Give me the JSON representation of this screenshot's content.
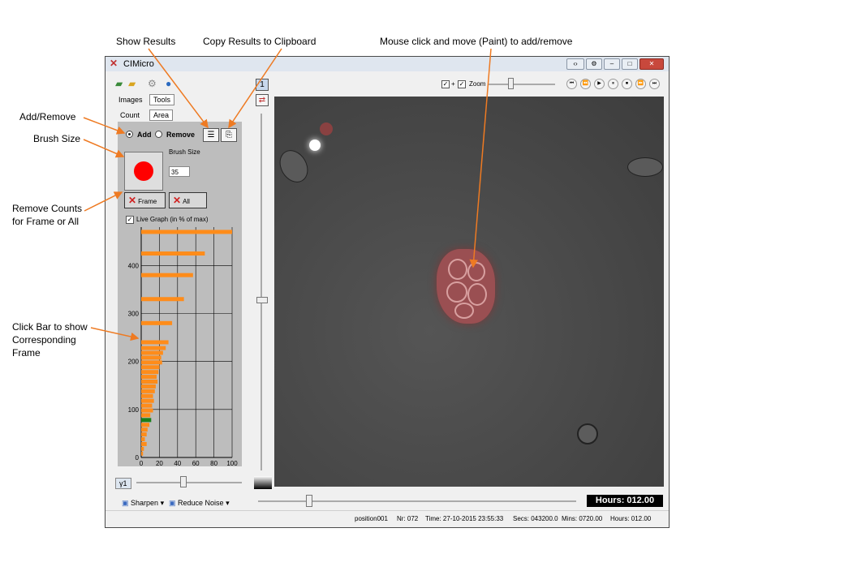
{
  "callouts": {
    "show_results": "Show Results",
    "copy_results": "Copy  Results to Clipboard",
    "mouse_click": "Mouse click and move (Paint) to add/remove",
    "add_remove": "Add/Remove",
    "brush_size": "Brush Size",
    "remove_counts_1": "Remove Counts",
    "remove_counts_2": "for Frame or All",
    "click_bar_1": "Click Bar to show",
    "click_bar_2": "Corresponding",
    "click_bar_3": "Frame"
  },
  "window": {
    "title": "CIMicro"
  },
  "left_panel": {
    "tabs": {
      "images": "Images",
      "tools": "Tools",
      "count": "Count",
      "area": "Area"
    },
    "mode": {
      "add": "Add",
      "remove": "Remove",
      "selected": "Add"
    },
    "brush_label": "Brush Size",
    "brush_value": "35",
    "remove_frame": "Frame",
    "remove_all": "All",
    "live_graph": "Live Graph (in % of max)",
    "gamma_label": "γ1",
    "sharpen": "Sharpen",
    "reduce_noise": "Reduce Noise",
    "colors": {
      "bar": "#ff8c1a",
      "selected_bar": "#1a7f1a",
      "panel": "#bdbdbd"
    }
  },
  "chart_data": {
    "type": "bar",
    "orientation": "horizontal",
    "xlim": [
      0,
      100
    ],
    "ylim": [
      0,
      480
    ],
    "xticks": [
      0,
      20,
      40,
      60,
      80,
      100
    ],
    "yticks": [
      0,
      100,
      200,
      300,
      400
    ],
    "bars": [
      {
        "y": 470,
        "x": 100
      },
      {
        "y": 425,
        "x": 70
      },
      {
        "y": 380,
        "x": 57
      },
      {
        "y": 330,
        "x": 47
      },
      {
        "y": 280,
        "x": 34
      },
      {
        "y": 240,
        "x": 30
      },
      {
        "y": 228,
        "x": 27
      },
      {
        "y": 218,
        "x": 24
      },
      {
        "y": 208,
        "x": 22
      },
      {
        "y": 198,
        "x": 23
      },
      {
        "y": 188,
        "x": 20
      },
      {
        "y": 178,
        "x": 19
      },
      {
        "y": 168,
        "x": 17
      },
      {
        "y": 158,
        "x": 18
      },
      {
        "y": 148,
        "x": 16
      },
      {
        "y": 138,
        "x": 15
      },
      {
        "y": 128,
        "x": 13
      },
      {
        "y": 118,
        "x": 14
      },
      {
        "y": 108,
        "x": 12
      },
      {
        "y": 98,
        "x": 13
      },
      {
        "y": 88,
        "x": 10
      },
      {
        "y": 78,
        "x": 11,
        "selected": true
      },
      {
        "y": 68,
        "x": 9
      },
      {
        "y": 58,
        "x": 7
      },
      {
        "y": 48,
        "x": 6
      },
      {
        "y": 38,
        "x": 4
      },
      {
        "y": 28,
        "x": 6
      },
      {
        "y": 18,
        "x": 3
      },
      {
        "y": 8,
        "x": 2
      }
    ]
  },
  "viewer": {
    "zoom_label": "Zoom",
    "hours_display": "Hours: 012.00"
  },
  "status": {
    "position": "position001",
    "nr": "Nr: 072",
    "time": "Time: 27-10-2015 23:55:33",
    "secs": "Secs: 043200.0",
    "mins": "Mins: 0720.00",
    "hours": "Hours: 012.00"
  }
}
